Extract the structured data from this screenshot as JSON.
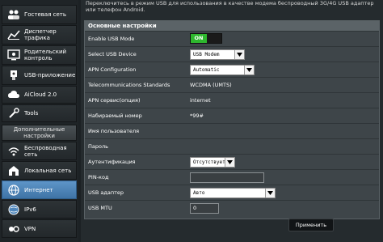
{
  "sidebar": {
    "items_top": [
      {
        "label": "Гостевая сеть",
        "icon": "guest-network-icon"
      },
      {
        "label": "Диспетчер трафика",
        "icon": "traffic-manager-icon"
      },
      {
        "label": "Родительский контроль",
        "icon": "parental-control-icon"
      },
      {
        "label": "USB-приложение",
        "icon": "usb-app-icon"
      },
      {
        "label": "AiCloud 2.0",
        "icon": "aicloud-icon"
      },
      {
        "label": "Tools",
        "icon": "tools-icon"
      }
    ],
    "section_header": "Дополнительные настройки",
    "items_bottom": [
      {
        "label": "Беспроводная сеть",
        "icon": "wireless-icon"
      },
      {
        "label": "Локальная сеть",
        "icon": "lan-icon"
      },
      {
        "label": "Интернет",
        "icon": "internet-globe-icon",
        "active": true
      },
      {
        "label": "IPv6",
        "icon": "ipv6-globe-icon"
      },
      {
        "label": "VPN",
        "icon": "vpn-icon"
      }
    ]
  },
  "main": {
    "intro_text": "Переключитесь в режим USB для использования в качестве модема беспроводный 3G/4G USB адаптер или телефон Android.",
    "panel_title": "Основные настройки",
    "rows": {
      "enable_usb_mode": {
        "label": "Enable USB Mode",
        "toggle_label": "ON"
      },
      "select_usb_device": {
        "label": "Select USB Device",
        "value": "USB Modem"
      },
      "apn_configuration": {
        "label": "APN Configuration",
        "value": "Automatic"
      },
      "telecom_standards": {
        "label": "Telecommunications Standards",
        "value": "WCDMA (UMTS)"
      },
      "apn_service": {
        "label": "APN сервис(опция)",
        "value": "internet"
      },
      "dial_number": {
        "label": "Набираемый номер",
        "value": "*99#"
      },
      "username": {
        "label": "Имя пользователя",
        "value": ""
      },
      "password": {
        "label": "Пароль",
        "value": ""
      },
      "authentication": {
        "label": "Аутентификация",
        "value": "Отсутствует"
      },
      "pin_code": {
        "label": "PIN-код",
        "value": ""
      },
      "usb_adapter": {
        "label": "USB адаптер",
        "value": "Авто"
      },
      "usb_mtu": {
        "label": "USB MTU",
        "value": "0"
      }
    },
    "apply_label": "Применить"
  },
  "colors": {
    "accent_active": "#4f86ba",
    "toggle_on": "#2eb82e",
    "panel_bg": "#3e4549"
  }
}
